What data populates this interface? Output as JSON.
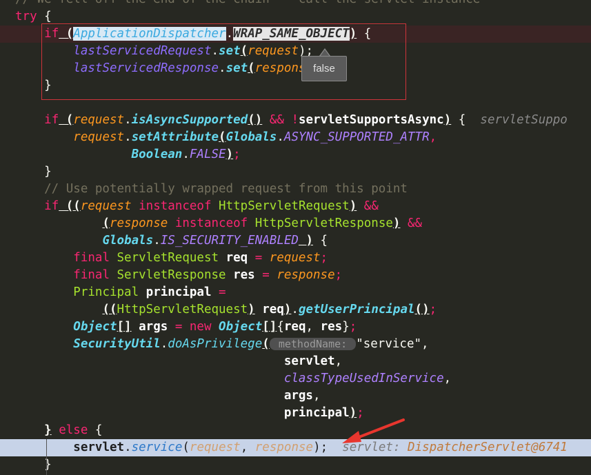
{
  "code_lines": [
    {
      "tokens": [
        {
          "t": "// We fell off the end of the chain -- call the servlet instance",
          "c": "t-cmt"
        }
      ]
    },
    {
      "tokens": [
        {
          "t": "try",
          "c": "t-kw"
        },
        {
          "t": " {",
          "c": "t-txt"
        }
      ]
    },
    {
      "hl": "err",
      "tokens": [
        {
          "t": "    ",
          "c": "t-txt"
        },
        {
          "t": "if",
          "c": "t-kw"
        },
        {
          "t": " (",
          "c": "t-punct"
        },
        {
          "t": "ApplicationDispatcher",
          "c": "t-sel"
        },
        {
          "t": ".",
          "c": "t-txt"
        },
        {
          "t": "WRAP_SAME_OBJECT",
          "c": "t-selb"
        },
        {
          "t": ")",
          "c": "t-punct"
        },
        {
          "t": " {",
          "c": "t-txt"
        }
      ]
    },
    {
      "tokens": [
        {
          "t": "        ",
          "c": "t-txt"
        },
        {
          "t": "lastServicedRequest",
          "c": "t-fieldi"
        },
        {
          "t": ".",
          "c": "t-txt"
        },
        {
          "t": "set",
          "c": "t-methodb"
        },
        {
          "t": "(",
          "c": "t-punct"
        },
        {
          "t": "request",
          "c": "t-param"
        },
        {
          "t": ");",
          "c": "t-txt"
        }
      ]
    },
    {
      "tokens": [
        {
          "t": "        ",
          "c": "t-txt"
        },
        {
          "t": "lastServicedResponse",
          "c": "t-fieldi"
        },
        {
          "t": ".",
          "c": "t-txt"
        },
        {
          "t": "set",
          "c": "t-methodb"
        },
        {
          "t": "(",
          "c": "t-punct"
        },
        {
          "t": "response",
          "c": "t-param"
        },
        {
          "t": ");",
          "c": "t-txt"
        }
      ]
    },
    {
      "tokens": [
        {
          "t": "    }",
          "c": "t-txt"
        }
      ]
    },
    {
      "tokens": []
    },
    {
      "tokens": [
        {
          "t": "    ",
          "c": "t-txt"
        },
        {
          "t": "if",
          "c": "t-kw"
        },
        {
          "t": " (",
          "c": "t-punct"
        },
        {
          "t": "request",
          "c": "t-param"
        },
        {
          "t": ".",
          "c": "t-txt"
        },
        {
          "t": "isAsyncSupported",
          "c": "t-methodb"
        },
        {
          "t": "()",
          "c": "t-punct"
        },
        {
          "t": " && ",
          "c": "t-kw"
        },
        {
          "t": "!",
          "c": "t-kw"
        },
        {
          "t": "servletSupportsAsync",
          "c": "t-bold"
        },
        {
          "t": ")",
          "c": "t-punct"
        },
        {
          "t": " {  ",
          "c": "t-txt"
        },
        {
          "t": "servletSuppo",
          "c": "t-inline"
        }
      ]
    },
    {
      "tokens": [
        {
          "t": "        ",
          "c": "t-txt"
        },
        {
          "t": "request",
          "c": "t-param"
        },
        {
          "t": ".",
          "c": "t-txt"
        },
        {
          "t": "setAttribute",
          "c": "t-methodb"
        },
        {
          "t": "(",
          "c": "t-punct"
        },
        {
          "t": "Globals",
          "c": "t-typei"
        },
        {
          "t": ".",
          "c": "t-txt"
        },
        {
          "t": "ASYNC_SUPPORTED_ATTR",
          "c": "t-field"
        },
        {
          "t": ",",
          "c": "t-kw"
        }
      ]
    },
    {
      "tokens": [
        {
          "t": "                ",
          "c": "t-txt"
        },
        {
          "t": "Boolean",
          "c": "t-typei"
        },
        {
          "t": ".",
          "c": "t-txt"
        },
        {
          "t": "FALSE",
          "c": "t-field"
        },
        {
          "t": ")",
          "c": "t-punct"
        },
        {
          "t": ";",
          "c": "t-kw"
        }
      ]
    },
    {
      "tokens": [
        {
          "t": "    }",
          "c": "t-txt"
        }
      ]
    },
    {
      "tokens": [
        {
          "t": "    // Use potentially wrapped request from this point",
          "c": "t-cmt"
        }
      ]
    },
    {
      "tokens": [
        {
          "t": "    ",
          "c": "t-txt"
        },
        {
          "t": "if",
          "c": "t-kw"
        },
        {
          "t": " ((",
          "c": "t-punct"
        },
        {
          "t": "request",
          "c": "t-param"
        },
        {
          "t": " instanceof ",
          "c": "t-kw"
        },
        {
          "t": "HttpServletRequest",
          "c": "t-type"
        },
        {
          "t": ")",
          "c": "t-punct"
        },
        {
          "t": " &&",
          "c": "t-kw"
        }
      ]
    },
    {
      "tokens": [
        {
          "t": "            ",
          "c": "t-txt"
        },
        {
          "t": "(",
          "c": "t-punct"
        },
        {
          "t": "response",
          "c": "t-param"
        },
        {
          "t": " instanceof ",
          "c": "t-kw"
        },
        {
          "t": "HttpServletResponse",
          "c": "t-type"
        },
        {
          "t": ")",
          "c": "t-punct"
        },
        {
          "t": " &&",
          "c": "t-kw"
        }
      ]
    },
    {
      "tokens": [
        {
          "t": "            ",
          "c": "t-txt"
        },
        {
          "t": "Globals",
          "c": "t-typei"
        },
        {
          "t": ".",
          "c": "t-txt"
        },
        {
          "t": "IS_SECURITY_ENABLED",
          "c": "t-field"
        },
        {
          "t": " )",
          "c": "t-punct"
        },
        {
          "t": " {",
          "c": "t-txt"
        }
      ]
    },
    {
      "tokens": [
        {
          "t": "        ",
          "c": "t-txt"
        },
        {
          "t": "final",
          "c": "t-kw"
        },
        {
          "t": " ServletRequest ",
          "c": "t-type"
        },
        {
          "t": "req",
          "c": "t-bold"
        },
        {
          "t": " = ",
          "c": "t-kw"
        },
        {
          "t": "request",
          "c": "t-param"
        },
        {
          "t": ";",
          "c": "t-kw"
        }
      ]
    },
    {
      "tokens": [
        {
          "t": "        ",
          "c": "t-txt"
        },
        {
          "t": "final",
          "c": "t-kw"
        },
        {
          "t": " ServletResponse ",
          "c": "t-type"
        },
        {
          "t": "res",
          "c": "t-bold"
        },
        {
          "t": " = ",
          "c": "t-kw"
        },
        {
          "t": "response",
          "c": "t-param"
        },
        {
          "t": ";",
          "c": "t-kw"
        }
      ]
    },
    {
      "tokens": [
        {
          "t": "        ",
          "c": "t-txt"
        },
        {
          "t": "Principal ",
          "c": "t-type"
        },
        {
          "t": "principal",
          "c": "t-bold"
        },
        {
          "t": " =",
          "c": "t-kw"
        }
      ]
    },
    {
      "tokens": [
        {
          "t": "            ",
          "c": "t-txt"
        },
        {
          "t": "((",
          "c": "t-punct"
        },
        {
          "t": "HttpServletRequest",
          "c": "t-type"
        },
        {
          "t": ")",
          "c": "t-punct"
        },
        {
          "t": " req",
          "c": "t-bold"
        },
        {
          "t": ")",
          "c": "t-punct"
        },
        {
          "t": ".",
          "c": "t-txt"
        },
        {
          "t": "getUserPrincipal",
          "c": "t-methodb"
        },
        {
          "t": "()",
          "c": "t-punct"
        },
        {
          "t": ";",
          "c": "t-kw"
        }
      ]
    },
    {
      "tokens": [
        {
          "t": "        ",
          "c": "t-txt"
        },
        {
          "t": "Object",
          "c": "t-typei"
        },
        {
          "t": "[]",
          "c": "t-punct"
        },
        {
          "t": " args",
          "c": "t-bold"
        },
        {
          "t": " = ",
          "c": "t-kw"
        },
        {
          "t": "new ",
          "c": "t-kw"
        },
        {
          "t": "Object",
          "c": "t-typei"
        },
        {
          "t": "[]",
          "c": "t-punct"
        },
        {
          "t": "{",
          "c": "t-txt"
        },
        {
          "t": "req",
          "c": "t-bold"
        },
        {
          "t": ", ",
          "c": "t-txt"
        },
        {
          "t": "res",
          "c": "t-bold"
        },
        {
          "t": "}",
          "c": "t-txt"
        },
        {
          "t": ";",
          "c": "t-kw"
        }
      ]
    },
    {
      "tokens": [
        {
          "t": "        ",
          "c": "t-txt"
        },
        {
          "t": "SecurityUtil",
          "c": "t-typei"
        },
        {
          "t": ".",
          "c": "t-txt"
        },
        {
          "t": "doAsPrivilege",
          "c": "t-methodi"
        },
        {
          "t": "(",
          "c": "t-punct"
        },
        {
          "t": " methodName: ",
          "c": "t-hint"
        },
        {
          "t": "\"service\"",
          "c": "t-txt"
        },
        {
          "t": ",",
          "c": "t-txt"
        }
      ]
    },
    {
      "tokens": [
        {
          "t": "                                     ",
          "c": "t-txt"
        },
        {
          "t": "servlet",
          "c": "t-bold"
        },
        {
          "t": ",",
          "c": "t-txt"
        }
      ]
    },
    {
      "tokens": [
        {
          "t": "                                     ",
          "c": "t-txt"
        },
        {
          "t": "classTypeUsedInService",
          "c": "t-field"
        },
        {
          "t": ",",
          "c": "t-txt"
        }
      ]
    },
    {
      "tokens": [
        {
          "t": "                                     ",
          "c": "t-txt"
        },
        {
          "t": "args",
          "c": "t-bold"
        },
        {
          "t": ",",
          "c": "t-txt"
        }
      ]
    },
    {
      "tokens": [
        {
          "t": "                                     ",
          "c": "t-txt"
        },
        {
          "t": "principal",
          "c": "t-bold"
        },
        {
          "t": ")",
          "c": "t-punct"
        },
        {
          "t": ";",
          "c": "t-kw"
        }
      ]
    },
    {
      "tokens": [
        {
          "t": "    ",
          "c": "t-txt"
        },
        {
          "t": "}",
          "c": "t-punct"
        },
        {
          "t": " else ",
          "c": "t-kw"
        },
        {
          "t": "{",
          "c": "t-txt"
        }
      ]
    },
    {
      "hl": "debug",
      "tokens": [
        {
          "t": "        ",
          "c": "t-txt"
        },
        {
          "t": "servlet",
          "c": "t-line-sel"
        },
        {
          "t": ".",
          "c": "t-line-punct"
        },
        {
          "t": "service",
          "c": "t-line-method"
        },
        {
          "t": "(",
          "c": "t-line-punct"
        },
        {
          "t": "request",
          "c": "t-line-param"
        },
        {
          "t": ", ",
          "c": "t-line-punct"
        },
        {
          "t": "response",
          "c": "t-line-param"
        },
        {
          "t": ");  ",
          "c": "t-line-punct"
        },
        {
          "t": "servlet: ",
          "c": "t-line-inline"
        },
        {
          "t": "DispatcherServlet@6741",
          "c": "t-line-inlineval"
        }
      ]
    },
    {
      "tokens": [
        {
          "t": "    }",
          "c": "t-txt"
        }
      ]
    }
  ],
  "tooltip": {
    "text": "false"
  },
  "colors": {
    "background": "#272822",
    "selection_box": "#d0343b",
    "debug_line": "#c7d3e8",
    "annotation_arrow": "#e8362e"
  }
}
